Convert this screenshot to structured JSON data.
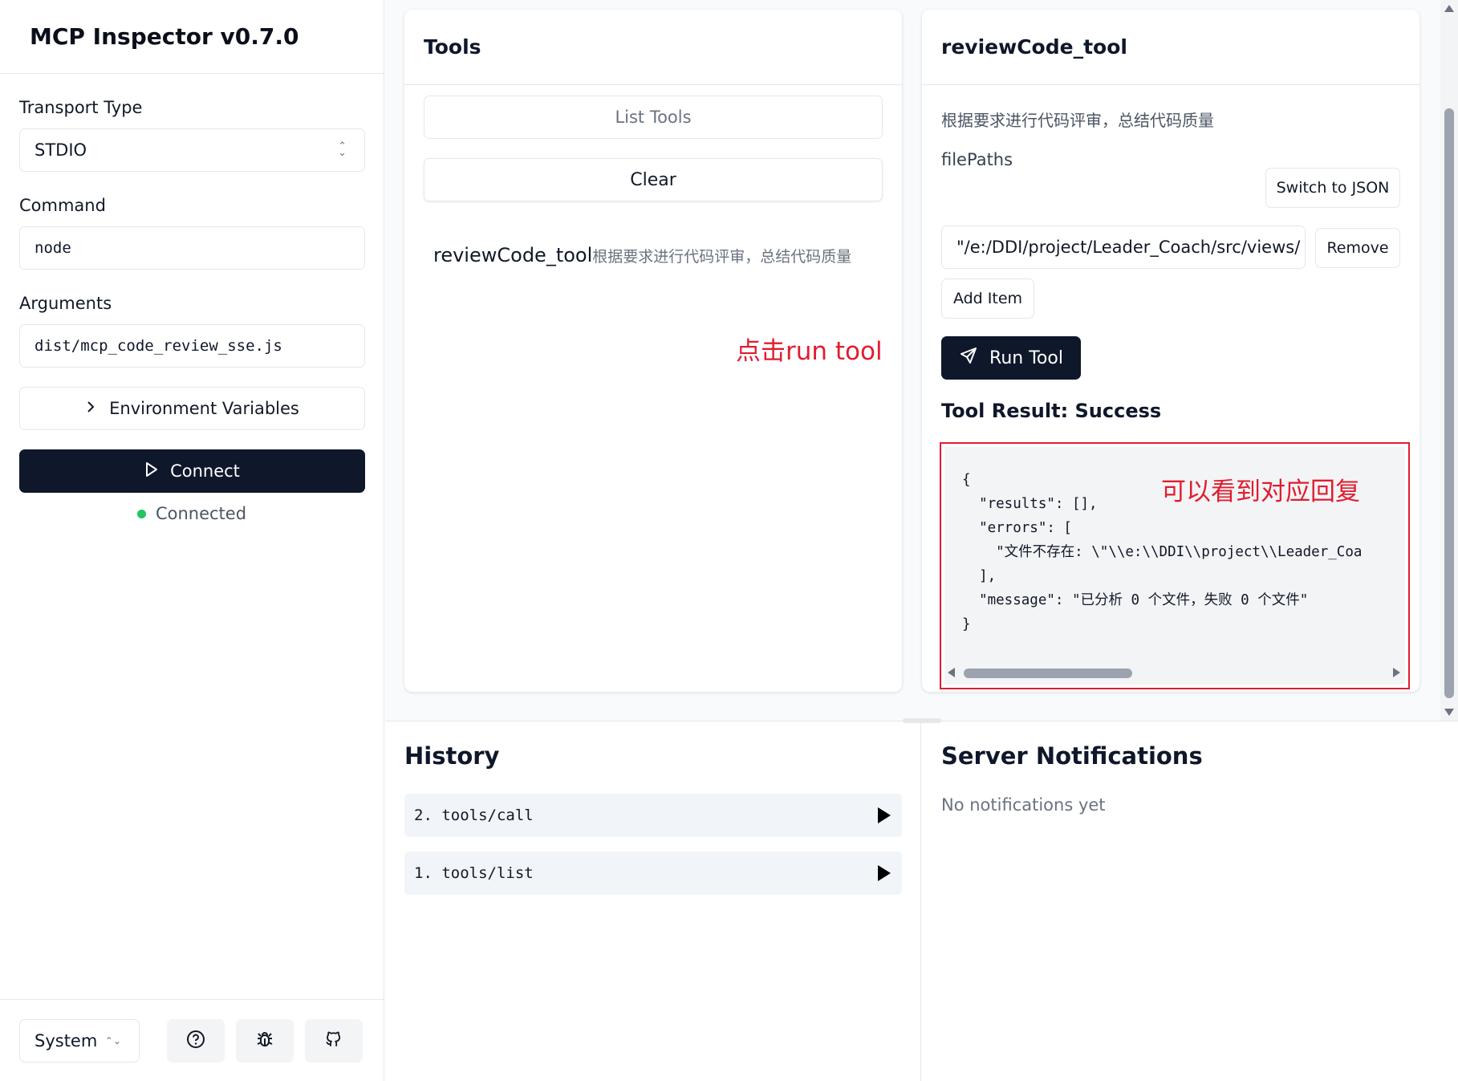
{
  "sidebar": {
    "app_title": "MCP Inspector v0.7.0",
    "transport_label": "Transport Type",
    "transport_value": "STDIO",
    "command_label": "Command",
    "command_value": "node",
    "arguments_label": "Arguments",
    "arguments_value": "dist/mcp_code_review_sse.js",
    "env_button": "Environment Variables",
    "connect_button": "Connect",
    "status_text": "Connected",
    "theme_value": "System",
    "icons": [
      "help-icon",
      "bug-icon",
      "github-icon"
    ]
  },
  "tools_panel": {
    "title": "Tools",
    "list_button": "List Tools",
    "clear_button": "Clear",
    "tools": [
      {
        "name": "reviewCode_tool",
        "description": "根据要求进行代码评审，总结代码质量"
      }
    ],
    "annotation": "点击run tool"
  },
  "tool_detail": {
    "title": "reviewCode_tool",
    "description": "根据要求进行代码评审，总结代码质量",
    "param_name": "filePaths",
    "switch_button": "Switch to JSON",
    "path_value": "\"/e:/DDI/project/Leader_Coach/src/views/",
    "remove_button": "Remove",
    "add_item_button": "Add Item",
    "run_button": "Run Tool",
    "result_title": "Tool Result: Success",
    "result_lines": [
      "{",
      "  \"results\": [],",
      "  \"errors\": [",
      "    \"文件不存在: \\\"\\\\e:\\\\DDI\\\\project\\\\Leader_Coa",
      "  ],",
      "  \"message\": \"已分析 0 个文件，失败 0 个文件\"",
      "}"
    ],
    "annotation": "可以看到对应回复"
  },
  "history": {
    "title": "History",
    "items": [
      {
        "label": "2. tools/call"
      },
      {
        "label": "1. tools/list"
      }
    ]
  },
  "notifications": {
    "title": "Server Notifications",
    "empty_text": "No notifications yet"
  },
  "colors": {
    "primary": "#0f172a",
    "annotation_red": "#e11d2e",
    "connected_green": "#22c55e"
  }
}
